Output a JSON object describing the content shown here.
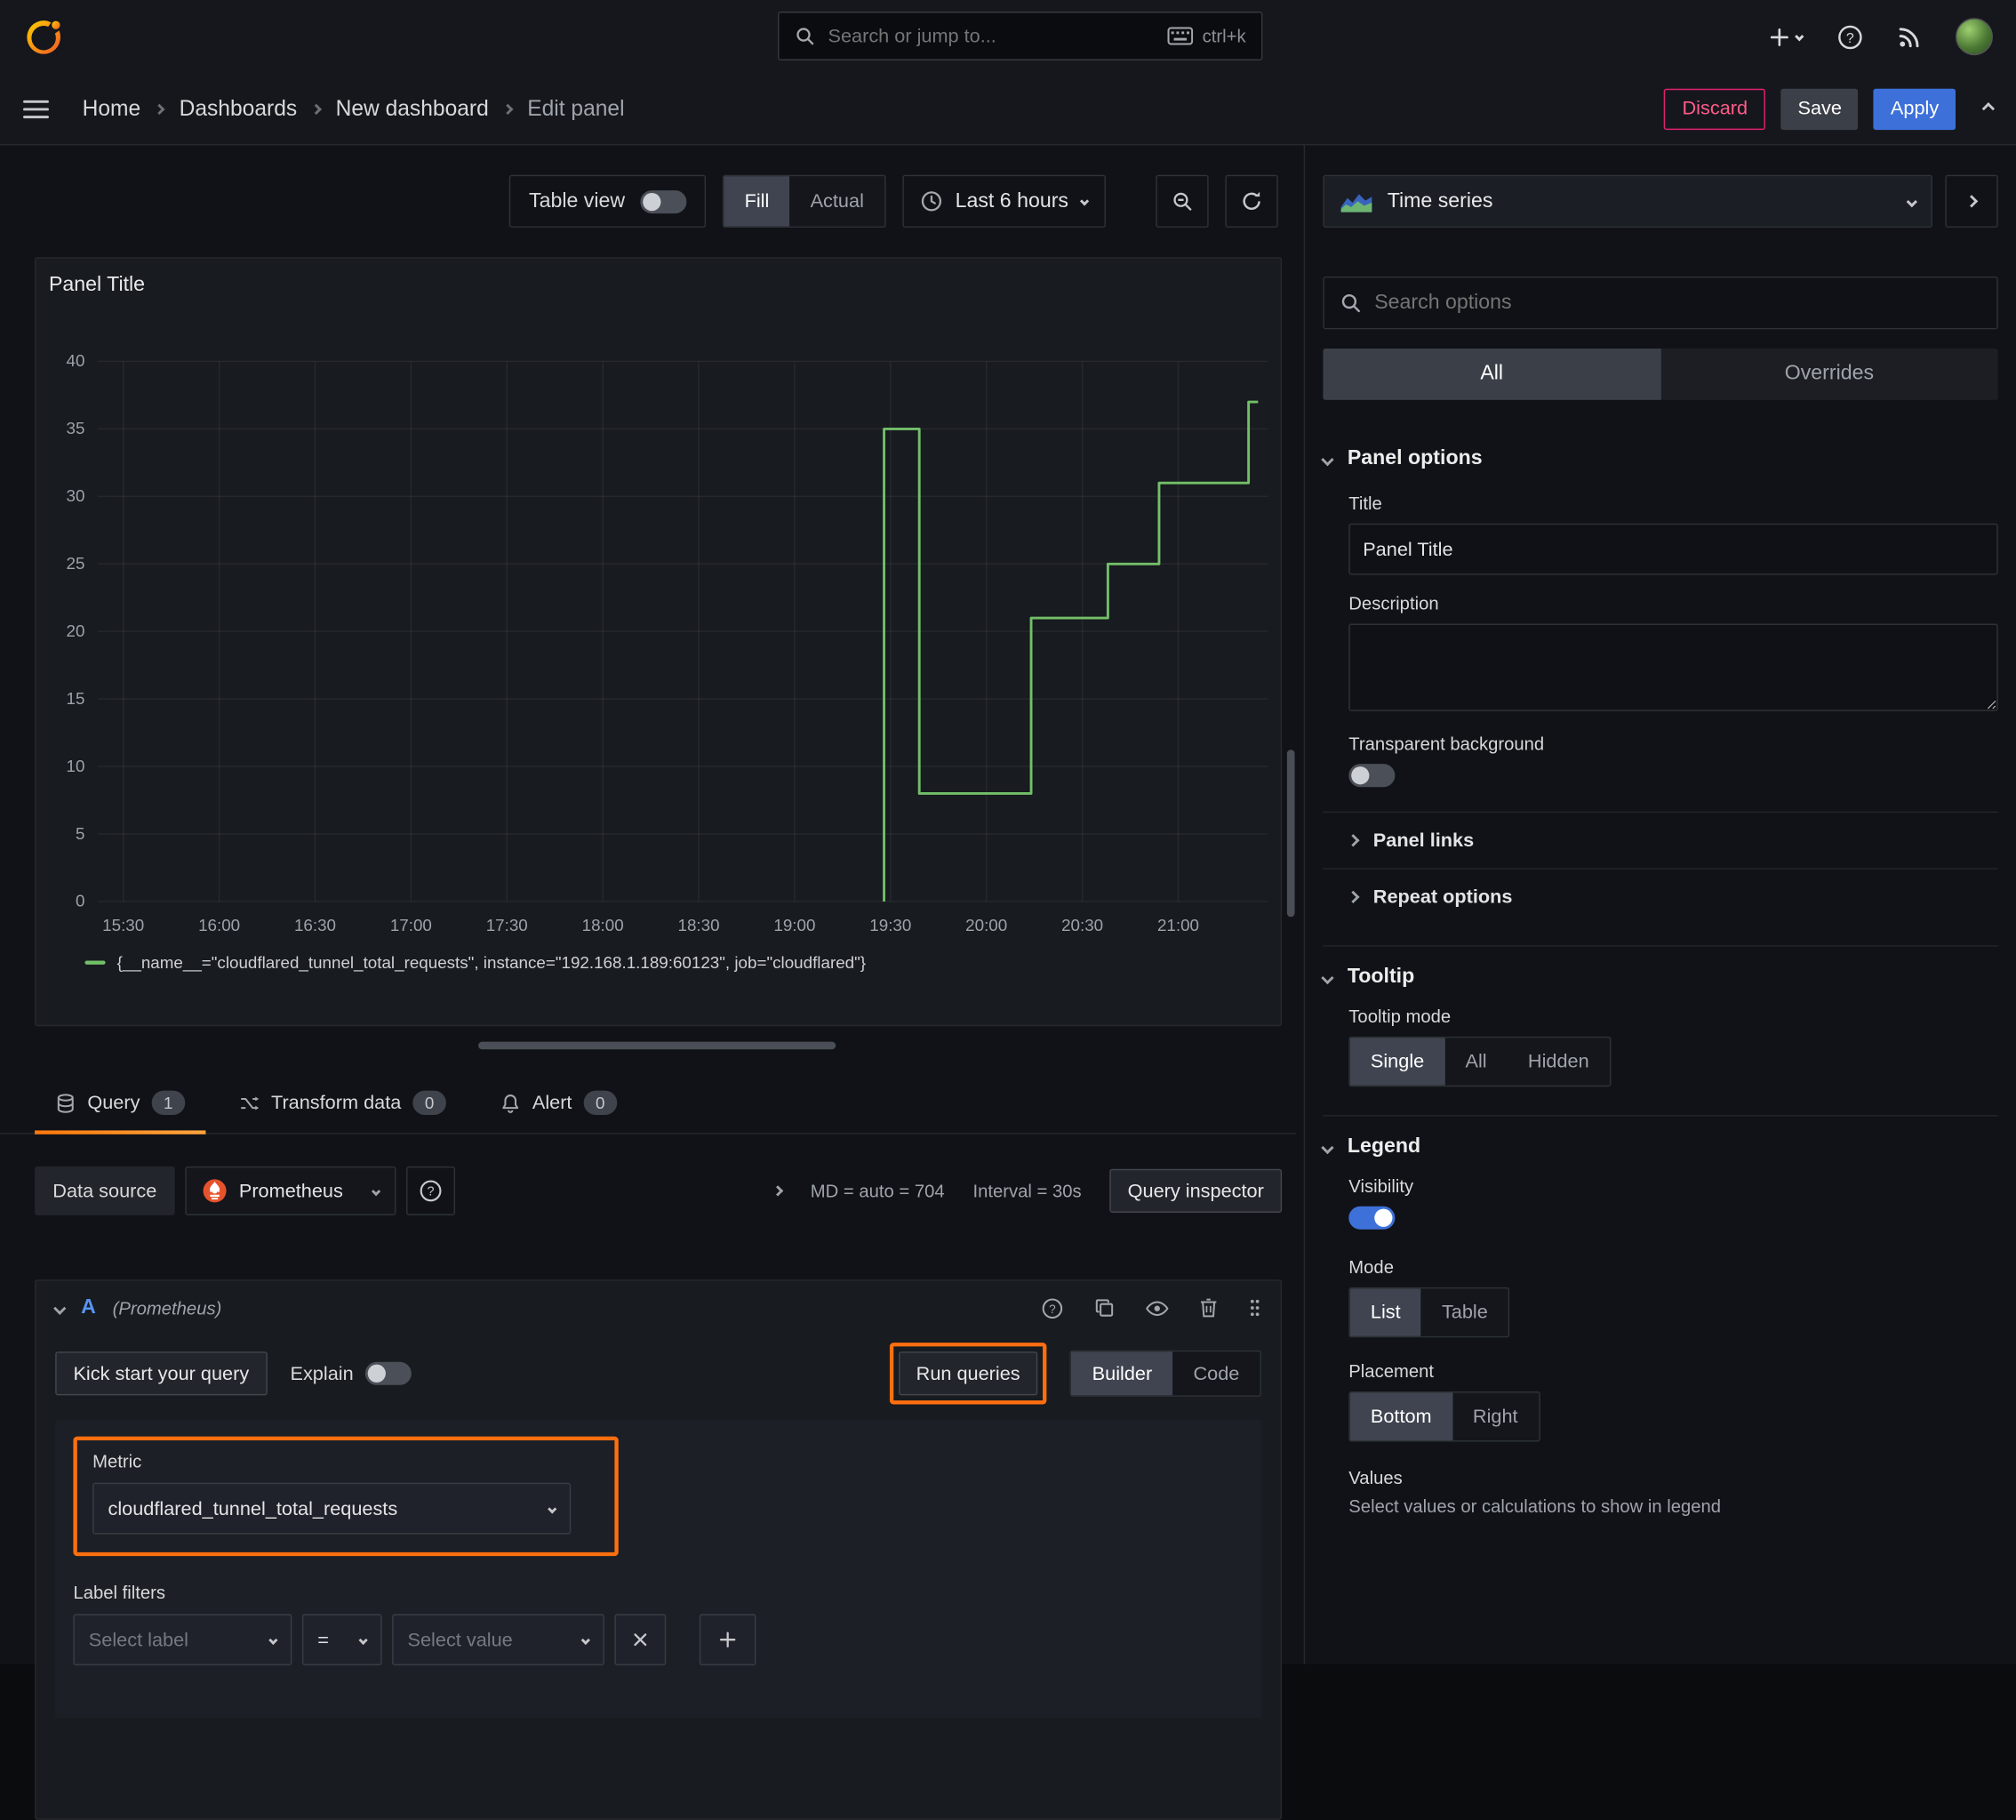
{
  "topbar": {
    "search_placeholder": "Search or jump to...",
    "shortcut": "ctrl+k"
  },
  "breadcrumb": {
    "items": [
      "Home",
      "Dashboards",
      "New dashboard",
      "Edit panel"
    ]
  },
  "actions": {
    "discard": "Discard",
    "save": "Save",
    "apply": "Apply"
  },
  "toolbar": {
    "table_view": "Table view",
    "fill": "Fill",
    "actual": "Actual",
    "time_range": "Last 6 hours"
  },
  "panel": {
    "title": "Panel Title"
  },
  "chart_data": {
    "type": "line",
    "title": "Panel Title",
    "x_unit": "time (minutes of day)",
    "x_range": [
      922,
      1288
    ],
    "x_ticks": [
      {
        "m": 930,
        "label": "15:30"
      },
      {
        "m": 960,
        "label": "16:00"
      },
      {
        "m": 990,
        "label": "16:30"
      },
      {
        "m": 1020,
        "label": "17:00"
      },
      {
        "m": 1050,
        "label": "17:30"
      },
      {
        "m": 1080,
        "label": "18:00"
      },
      {
        "m": 1110,
        "label": "18:30"
      },
      {
        "m": 1140,
        "label": "19:00"
      },
      {
        "m": 1170,
        "label": "19:30"
      },
      {
        "m": 1200,
        "label": "20:00"
      },
      {
        "m": 1230,
        "label": "20:30"
      },
      {
        "m": 1260,
        "label": "21:00"
      }
    ],
    "ylim": [
      0,
      40
    ],
    "y_ticks": [
      0,
      5,
      10,
      15,
      20,
      25,
      30,
      35,
      40
    ],
    "grid": true,
    "legend_position": "bottom",
    "series": [
      {
        "name": "{__name__=\"cloudflared_tunnel_total_requests\", instance=\"192.168.1.189:60123\", job=\"cloudflared\"}",
        "color": "#73bf69",
        "points": [
          [
            1168,
            0
          ],
          [
            1168,
            35
          ],
          [
            1179,
            35
          ],
          [
            1179,
            8
          ],
          [
            1214,
            8
          ],
          [
            1214,
            21
          ],
          [
            1238,
            21
          ],
          [
            1238,
            25
          ],
          [
            1254,
            25
          ],
          [
            1254,
            31
          ],
          [
            1282,
            31
          ],
          [
            1282,
            37
          ],
          [
            1285,
            37
          ]
        ]
      }
    ]
  },
  "tabs": {
    "query": "Query",
    "query_count": "1",
    "transform": "Transform data",
    "transform_count": "0",
    "alert": "Alert",
    "alert_count": "0"
  },
  "query": {
    "datasource_label": "Data source",
    "datasource": "Prometheus",
    "md_stat": "MD = auto = 704",
    "interval_stat": "Interval = 30s",
    "inspector": "Query inspector",
    "ref_id": "A",
    "ref_ds": "(Prometheus)",
    "kick_start": "Kick start your query",
    "explain": "Explain",
    "run": "Run queries",
    "builder": "Builder",
    "code": "Code",
    "metric_label": "Metric",
    "metric": "cloudflared_tunnel_total_requests",
    "label_filters": "Label filters",
    "select_label": "Select label",
    "op": "=",
    "select_value": "Select value"
  },
  "sidebar": {
    "viz": "Time series",
    "search_placeholder": "Search options",
    "tab_all": "All",
    "tab_overrides": "Overrides",
    "panel_options": "Panel options",
    "title_label": "Title",
    "title_value": "Panel Title",
    "description_label": "Description",
    "transparent_bg": "Transparent background",
    "panel_links": "Panel links",
    "repeat_options": "Repeat options",
    "tooltip": "Tooltip",
    "tooltip_mode": "Tooltip mode",
    "tt_single": "Single",
    "tt_all": "All",
    "tt_hidden": "Hidden",
    "legend": "Legend",
    "visibility": "Visibility",
    "mode": "Mode",
    "mode_list": "List",
    "mode_table": "Table",
    "placement": "Placement",
    "placement_bottom": "Bottom",
    "placement_right": "Right",
    "values": "Values",
    "values_desc": "Select values or calculations to show in legend"
  }
}
